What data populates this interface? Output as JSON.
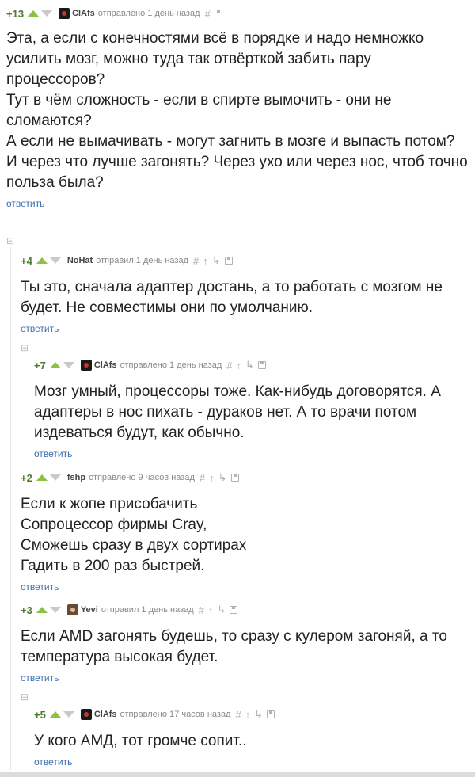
{
  "comments": [
    {
      "rating": "+13",
      "author": "ClAfs",
      "meta": "отправлено 1 день назад",
      "text": "Эта, а если с конечностями всё в порядке и надо немножко усилить мозг, можно туда так отвёрткой забить пару процессоров?\nТут в чём сложность - если в спирте вымочить - они не сломаются?\nА если не вымачивать - могут загнить в мозге и выпасть потом?\nИ через что лучше загонять? Через ухо или через нос, чтоб точно польза была?",
      "reply": "ответить"
    },
    {
      "rating": "+4",
      "author": "NoHat",
      "meta": "отправил 1 день назад",
      "text": "Ты это, сначала адаптер достань, а то работать с мозгом не будет. Не совместимы они по умолчанию.",
      "reply": "ответить"
    },
    {
      "rating": "+7",
      "author": "ClAfs",
      "meta": "отправлено 1 день назад",
      "text": "Мозг умный, процессоры тоже. Как-нибудь договорятся. А адаптеры в нос пихать - дураков нет. А то врачи потом издеваться будут, как обычно.",
      "reply": "ответить"
    },
    {
      "rating": "+2",
      "author": "fshp",
      "meta": "отправлено 9 часов назад",
      "text": "Если к жопе присобачить\nСопроцессор фирмы Cray,\nСможешь сразу в двух сортирах\nГадить в 200 раз быстрей.",
      "reply": "ответить"
    },
    {
      "rating": "+3",
      "author": "Yevi",
      "meta": "отправил 1 день назад",
      "text": "Если AMD загонять будешь, то сразу с кулером загоняй, а то температура высокая будет.",
      "reply": "ответить"
    },
    {
      "rating": "+5",
      "author": "ClAfs",
      "meta": "отправлено 17 часов назад",
      "text": "У кого АМД, тот громче сопит..",
      "reply": "ответить"
    }
  ],
  "icons": {
    "hash": "#",
    "up_tree": "↑",
    "branch": "↳",
    "collapse": "⊟"
  },
  "colors": {
    "rating": "#4a7a2a",
    "upvote": "#8ec044",
    "link": "#3a6fb0"
  }
}
